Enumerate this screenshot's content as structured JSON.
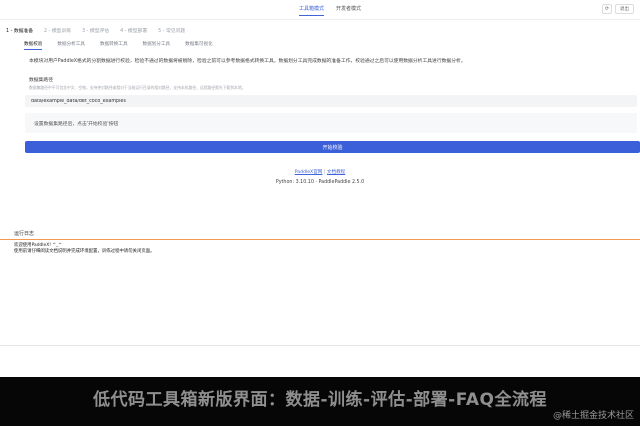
{
  "mode_tabs": [
    "工具箱模式",
    "开发者模式"
  ],
  "toolbar": {
    "logout_label": "退出",
    "icon": "refresh-icon"
  },
  "steps": [
    "1 - 数据准备",
    "2 - 模型训练",
    "3 - 模型评估",
    "4 - 模型部署",
    "5 - 常见问题"
  ],
  "subtabs": [
    "数据校验",
    "数据分析工具",
    "数据转换工具",
    "数据划分工具",
    "数据集可视化"
  ],
  "description": "本模块对用户PaddleX格式的分割数据进行校验，检验不通过的数据将被剔除，检验之前可以参考数据格式转换工具，数据划分工具完成数据的准备工作，校验通过之后可以使用数据分析工具进行数据分析。",
  "dataset": {
    "label": "数据集路径",
    "hint": "数据集路径中不可包含中文、空格，支持绝对路径或相对于当前运行目录的相对路径，支持本机路径，远程路径需先下载到本地。",
    "path": "data/example_data/det_coco_examples"
  },
  "status_message": "设置数据集路径后，点击'开始校验'按钮",
  "start_button": "开始校验",
  "links": [
    "PaddleX官网",
    "文档教程"
  ],
  "version": "Python: 3.10.10 · PaddlePaddle 2.5.0",
  "log": {
    "title": "运行日志",
    "lines": [
      "欢迎使用PaddleX! ^_^",
      "使用前请仔细阅读文档说明并完成环境配置，训练过程中请勿关闭页面。"
    ]
  },
  "caption": "低代码工具箱新版界面：数据-训练-评估-部署-FAQ全流程",
  "watermark": "@稀土掘金技术社区"
}
